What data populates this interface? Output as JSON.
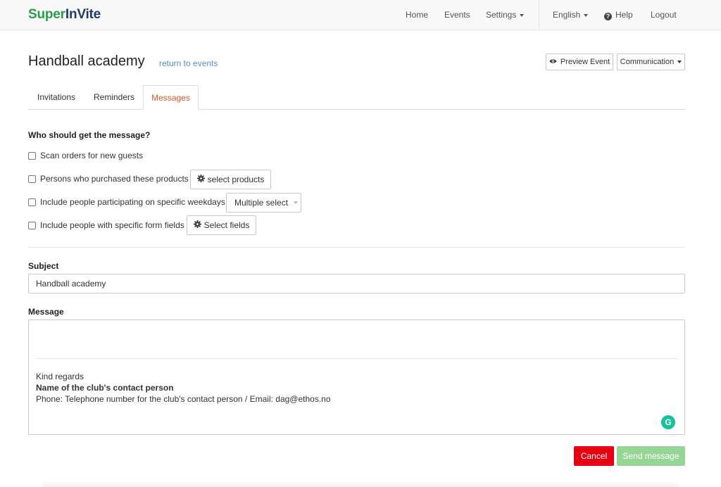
{
  "colors": {
    "brand_green": "#2a9d4a",
    "brand_navy": "#1f3a66",
    "active_tab": "#e0572a",
    "link": "#5b8dc9",
    "cancel": "#e60012",
    "send_disabled": "#97d597"
  },
  "brand": {
    "part1": "Super",
    "part2": "InVite"
  },
  "nav": {
    "home": "Home",
    "events": "Events",
    "settings": "Settings",
    "language": "English",
    "help": "Help",
    "logout": "Logout",
    "help_icon_glyph": "?"
  },
  "header": {
    "title": "Handball academy",
    "return_link": "return to events",
    "preview_button": "Preview Event",
    "communication_button": "Communication"
  },
  "tabs": [
    {
      "label": "Invitations",
      "active": false
    },
    {
      "label": "Reminders",
      "active": false
    },
    {
      "label": "Messages",
      "active": true
    }
  ],
  "recipients": {
    "heading": "Who should get the message?",
    "options": [
      {
        "label": "Scan orders for new guests",
        "checked": false
      },
      {
        "label": "Persons who purchased these products",
        "checked": false,
        "button": "select products"
      },
      {
        "label": "Include people participating on specific weekdays",
        "checked": false,
        "button": "Multiple select"
      },
      {
        "label": "Include people with specific form fields",
        "checked": false,
        "button": "Select fields"
      }
    ]
  },
  "subject": {
    "label": "Subject",
    "value": "Handball academy"
  },
  "message": {
    "label": "Message",
    "lines": [
      "Kind regards",
      "Name of the club's contact person",
      "Phone: Telephone number for the club's contact person / Email: dag@ethos.no"
    ],
    "grammarly_glyph": "G"
  },
  "actions": {
    "cancel": "Cancel",
    "send": "Send message"
  }
}
